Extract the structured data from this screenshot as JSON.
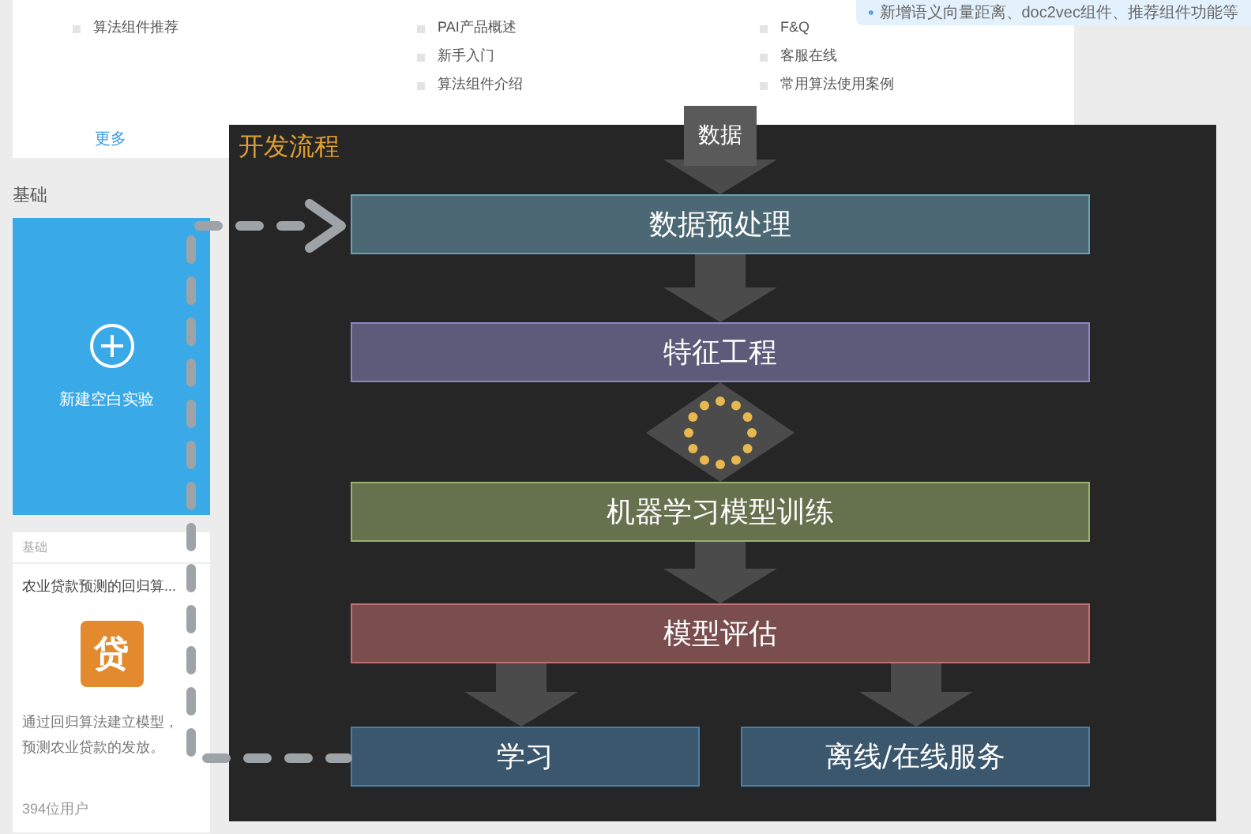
{
  "notification": {
    "text": "新增语义向量距离、doc2vec组件、推荐组件功能等"
  },
  "links": {
    "columns": [
      [
        "算法组件推荐"
      ],
      [
        "PAI产品概述",
        "新手入门",
        "算法组件介绍"
      ],
      [
        "F&Q",
        "客服在线",
        "常用算法使用案例"
      ]
    ],
    "more": "更多"
  },
  "section_title": "基础",
  "new_experiment": {
    "label": "新建空白实验"
  },
  "cards": [
    {
      "tag": "基础",
      "title": "农业贷款预测的回归算...",
      "icon_text": "贷",
      "description": "通过回归算法建立模型，预测农业贷款的发放。",
      "users": "394位用户"
    }
  ],
  "flow": {
    "title": "开发流程",
    "input": "数据",
    "steps": [
      {
        "label": "数据预处理",
        "color": "#6a9fb5"
      },
      {
        "label": "特征工程",
        "color": "#8a85c0"
      },
      {
        "label": "机器学习模型训练",
        "color": "#9ab070"
      },
      {
        "label": "模型评估",
        "color": "#c07070"
      }
    ],
    "outputs": [
      {
        "label": "学习",
        "color": "#4a7fa8"
      },
      {
        "label": "离线/在线服务",
        "color": "#4a7fa8"
      }
    ]
  }
}
